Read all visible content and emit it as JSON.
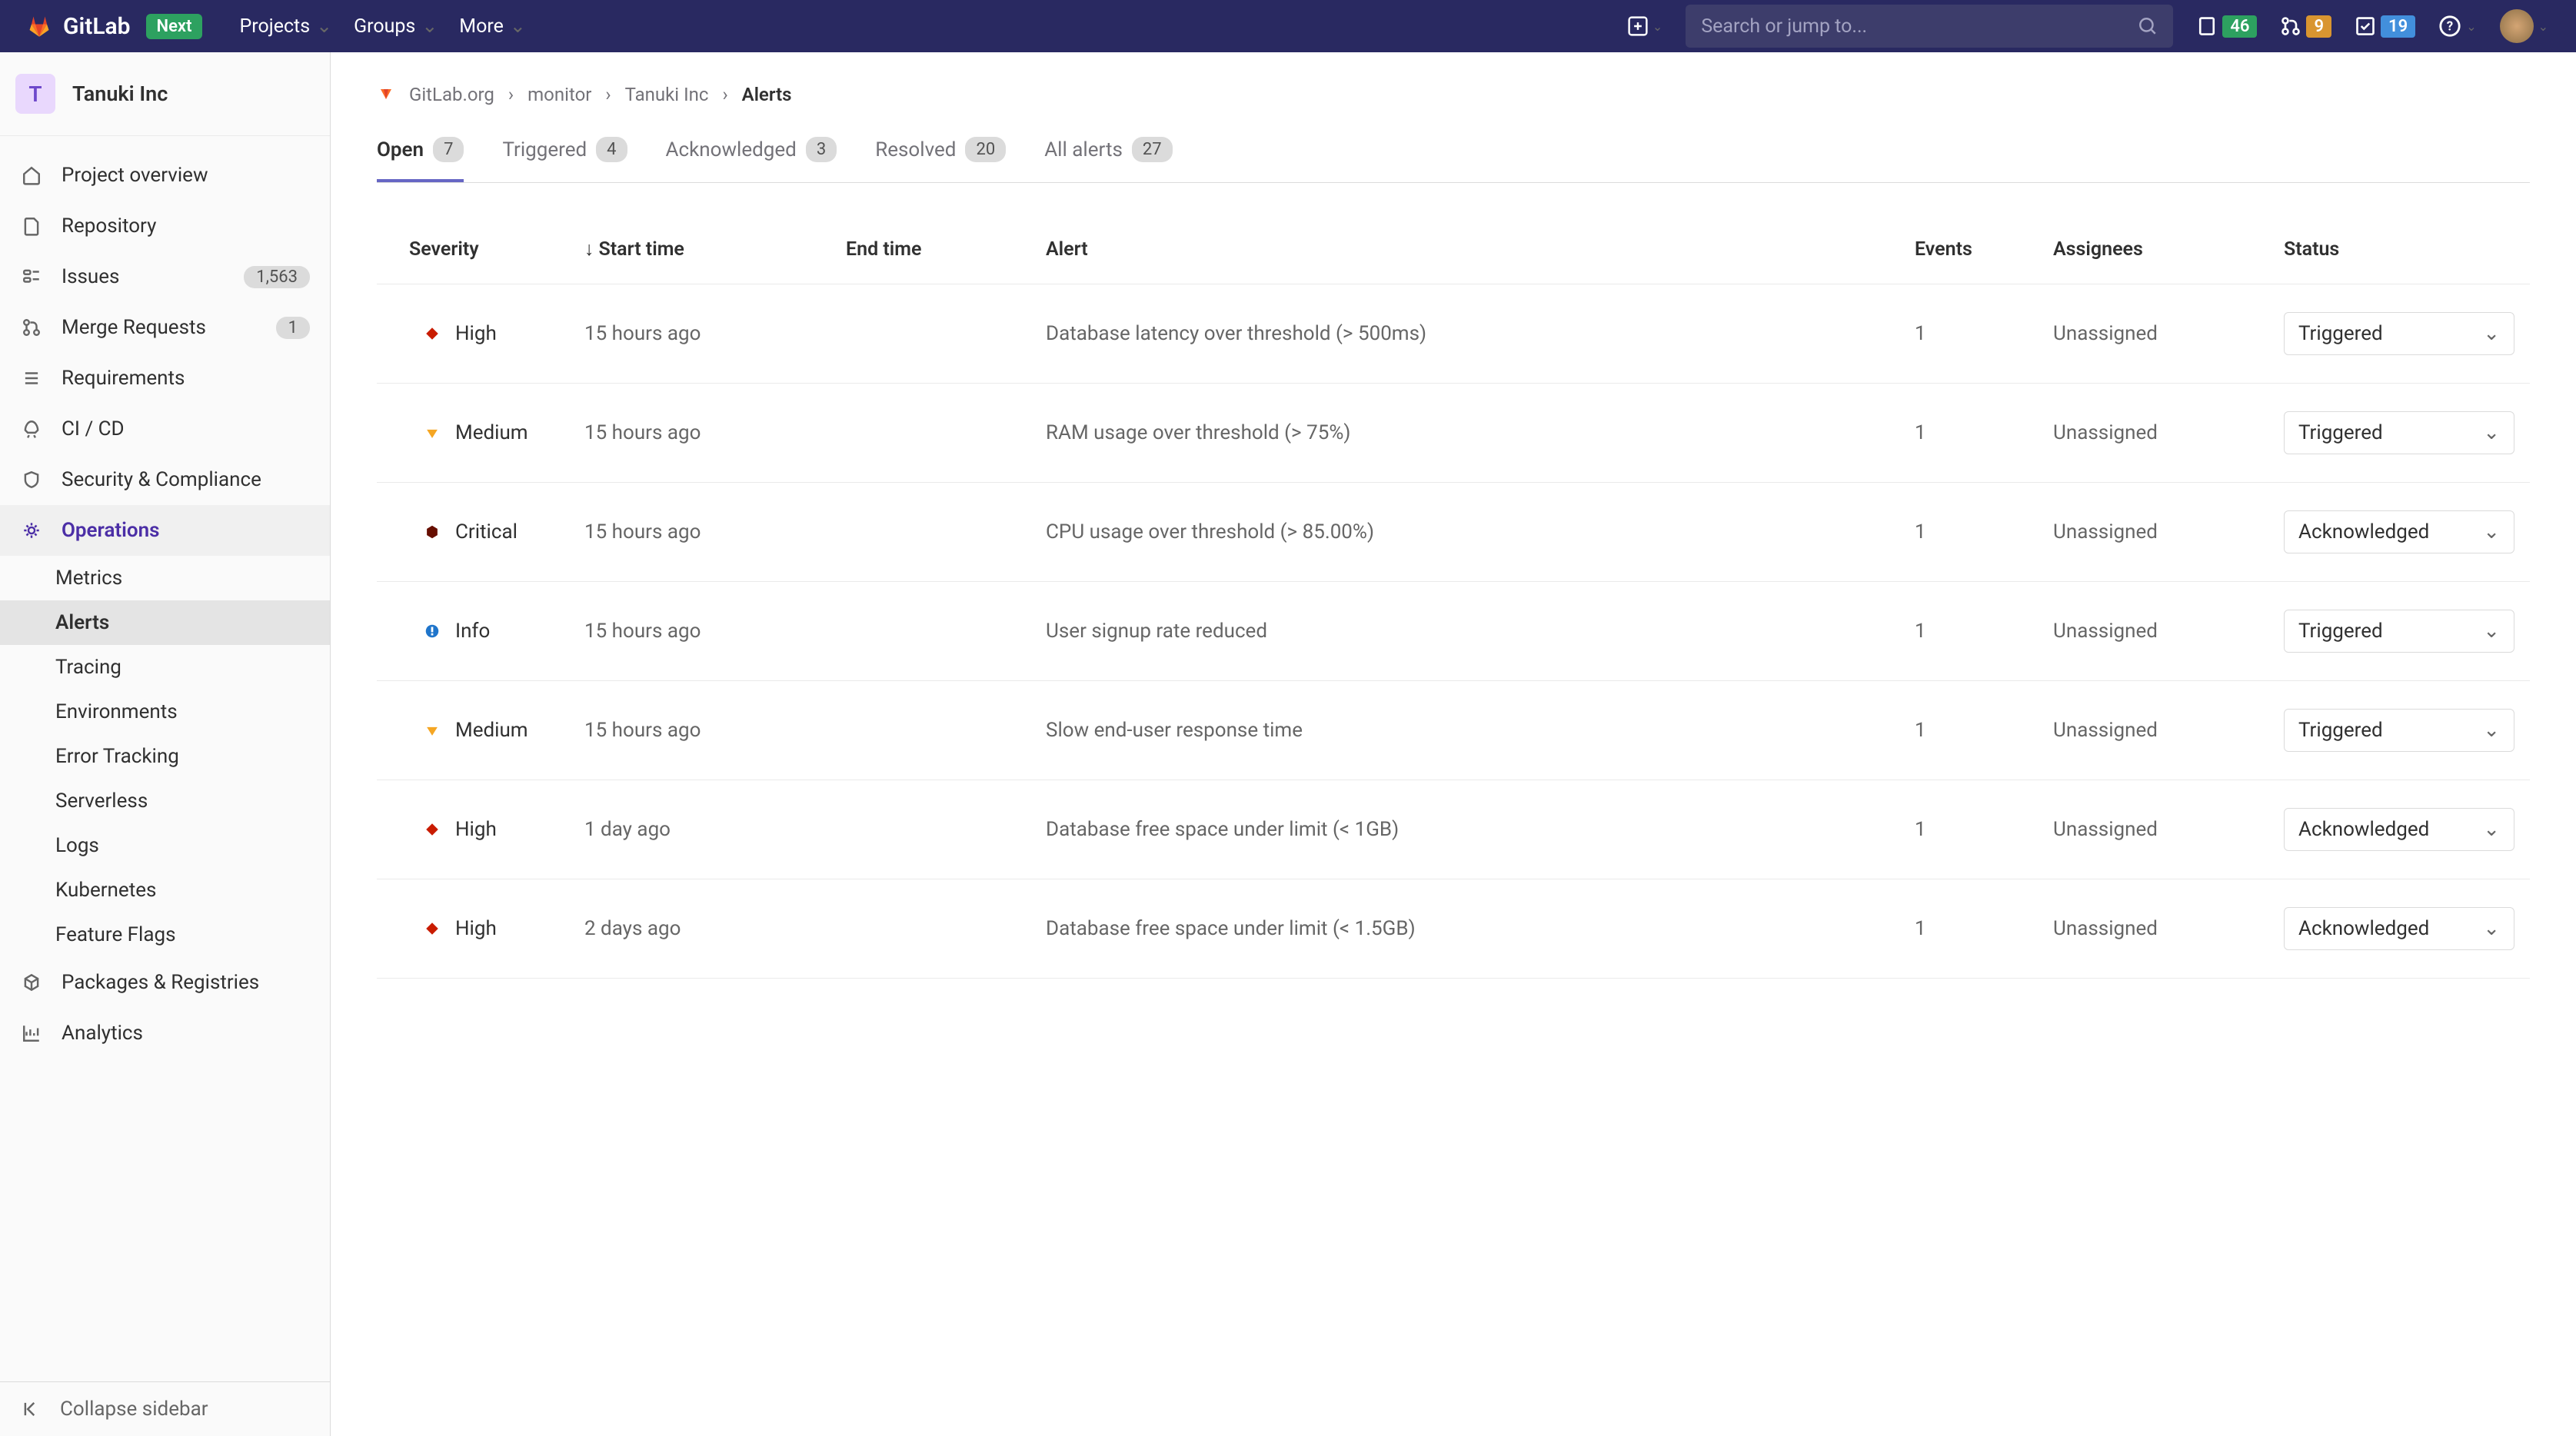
{
  "header": {
    "brand": "GitLab",
    "next_badge": "Next",
    "nav": [
      {
        "label": "Projects"
      },
      {
        "label": "Groups"
      },
      {
        "label": "More"
      }
    ],
    "search_placeholder": "Search or jump to...",
    "status_badges": {
      "todos": "46",
      "mrs": "9",
      "issues": "19"
    }
  },
  "sidebar": {
    "project_initial": "T",
    "project_name": "Tanuki Inc",
    "items": [
      {
        "icon": "home-icon",
        "label": "Project overview"
      },
      {
        "icon": "file-icon",
        "label": "Repository"
      },
      {
        "icon": "issue-icon",
        "label": "Issues",
        "count": "1,563"
      },
      {
        "icon": "merge-icon",
        "label": "Merge Requests",
        "count": "1"
      },
      {
        "icon": "list-icon",
        "label": "Requirements"
      },
      {
        "icon": "rocket-icon",
        "label": "CI / CD"
      },
      {
        "icon": "shield-icon",
        "label": "Security & Compliance"
      },
      {
        "icon": "cloud-gear-icon",
        "label": "Operations",
        "active": true
      },
      {
        "icon": "package-icon",
        "label": "Packages & Registries"
      },
      {
        "icon": "chart-icon",
        "label": "Analytics"
      }
    ],
    "operations_sub": [
      {
        "label": "Metrics"
      },
      {
        "label": "Alerts",
        "active": true
      },
      {
        "label": "Tracing"
      },
      {
        "label": "Environments"
      },
      {
        "label": "Error Tracking"
      },
      {
        "label": "Serverless"
      },
      {
        "label": "Logs"
      },
      {
        "label": "Kubernetes"
      },
      {
        "label": "Feature Flags"
      }
    ],
    "collapse_label": "Collapse sidebar"
  },
  "breadcrumb": [
    {
      "label": "GitLab.org"
    },
    {
      "label": "monitor"
    },
    {
      "label": "Tanuki Inc"
    },
    {
      "label": "Alerts",
      "current": true
    }
  ],
  "tabs": [
    {
      "label": "Open",
      "count": "7",
      "active": true
    },
    {
      "label": "Triggered",
      "count": "4"
    },
    {
      "label": "Acknowledged",
      "count": "3"
    },
    {
      "label": "Resolved",
      "count": "20"
    },
    {
      "label": "All alerts",
      "count": "27"
    }
  ],
  "columns": {
    "severity": "Severity",
    "start_time": "Start time",
    "end_time": "End time",
    "alert": "Alert",
    "events": "Events",
    "assignees": "Assignees",
    "status": "Status"
  },
  "alerts": [
    {
      "severity": "High",
      "sev_color": "#c91c00",
      "sev_shape": "diamond",
      "start": "15 hours ago",
      "end": "",
      "title": "Database latency over threshold (> 500ms)",
      "events": "1",
      "assignees": "Unassigned",
      "status": "Triggered"
    },
    {
      "severity": "Medium",
      "sev_color": "#f5a623",
      "sev_shape": "triangle-down",
      "start": "15 hours ago",
      "end": "",
      "title": "RAM usage over threshold (> 75%)",
      "events": "1",
      "assignees": "Unassigned",
      "status": "Triggered"
    },
    {
      "severity": "Critical",
      "sev_color": "#660e00",
      "sev_shape": "hexagon",
      "start": "15 hours ago",
      "end": "",
      "title": "CPU usage over threshold (> 85.00%)",
      "events": "1",
      "assignees": "Unassigned",
      "status": "Acknowledged"
    },
    {
      "severity": "Info",
      "sev_color": "#1f75cb",
      "sev_shape": "circle",
      "start": "15 hours ago",
      "end": "",
      "title": "User signup rate reduced",
      "events": "1",
      "assignees": "Unassigned",
      "status": "Triggered"
    },
    {
      "severity": "Medium",
      "sev_color": "#f5a623",
      "sev_shape": "triangle-down",
      "start": "15 hours ago",
      "end": "",
      "title": "Slow end-user response time",
      "events": "1",
      "assignees": "Unassigned",
      "status": "Triggered"
    },
    {
      "severity": "High",
      "sev_color": "#c91c00",
      "sev_shape": "diamond",
      "start": "1 day ago",
      "end": "",
      "title": "Database free space under limit (< 1GB)",
      "events": "1",
      "assignees": "Unassigned",
      "status": "Acknowledged"
    },
    {
      "severity": "High",
      "sev_color": "#c91c00",
      "sev_shape": "diamond",
      "start": "2 days ago",
      "end": "",
      "title": "Database free space under limit (< 1.5GB)",
      "events": "1",
      "assignees": "Unassigned",
      "status": "Acknowledged"
    }
  ]
}
